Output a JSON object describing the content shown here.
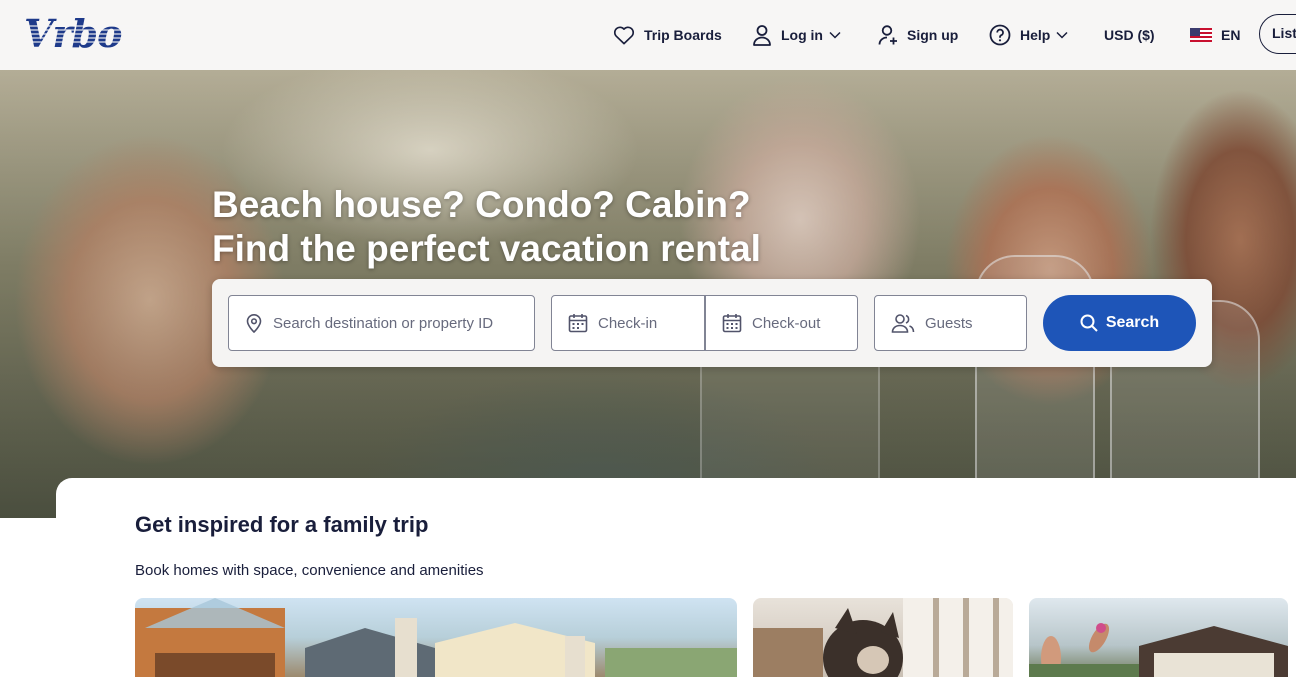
{
  "brand": {
    "logo_text": "Vrbo",
    "accent": "#1e55b8",
    "ink": "#191e3b"
  },
  "header": {
    "trip_boards": "Trip Boards",
    "log_in": "Log in",
    "sign_up": "Sign up",
    "help": "Help",
    "currency": "USD ($)",
    "language": "EN",
    "list_property": "List"
  },
  "hero": {
    "title_line1": "Beach house? Condo? Cabin?",
    "title_line2": "Find the perfect vacation rental"
  },
  "search": {
    "destination_placeholder": "Search destination or property ID",
    "checkin_placeholder": "Check-in",
    "checkout_placeholder": "Check-out",
    "guests_placeholder": "Guests",
    "button_label": "Search"
  },
  "inspiration": {
    "title": "Get inspired for a family trip",
    "subtitle": "Book homes with space, convenience and amenities"
  },
  "icons": {
    "heart": "heart-icon",
    "user": "user-icon",
    "user_plus": "user-plus-icon",
    "help": "help-circle-icon",
    "flag": "us-flag-icon",
    "pin": "map-pin-icon",
    "calendar": "calendar-icon",
    "guests": "guests-icon",
    "search": "search-icon"
  }
}
